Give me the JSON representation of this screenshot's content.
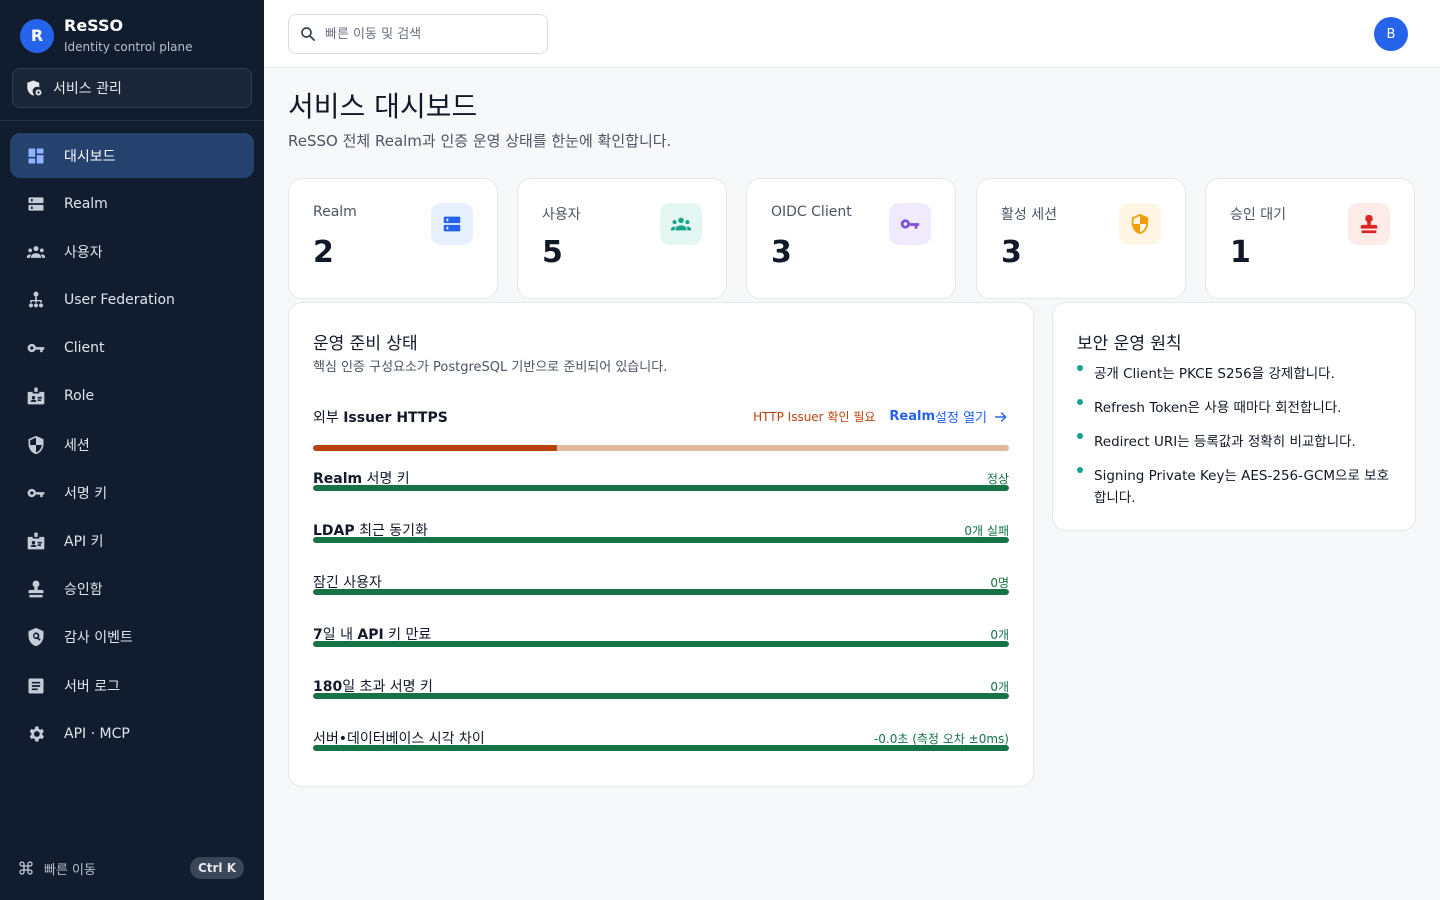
{
  "app": {
    "logo_letter": "R",
    "name": "ReSSO",
    "subtitle": "Identity control plane",
    "scope_label": "서비스 관리"
  },
  "sidebar": {
    "items": [
      {
        "label": "대시보드",
        "icon": "dashboard-icon",
        "active": true
      },
      {
        "label": "Realm",
        "icon": "server-icon"
      },
      {
        "label": "사용자",
        "icon": "users-icon"
      },
      {
        "label": "User Federation",
        "icon": "federation-icon"
      },
      {
        "label": "Client",
        "icon": "key-icon"
      },
      {
        "label": "Role",
        "icon": "badge-icon"
      },
      {
        "label": "세션",
        "icon": "shield-icon"
      },
      {
        "label": "서명 키",
        "icon": "key-icon"
      },
      {
        "label": "API 키",
        "icon": "badge-icon"
      },
      {
        "label": "승인함",
        "icon": "approval-icon"
      },
      {
        "label": "감사 이벤트",
        "icon": "audit-shield-icon"
      },
      {
        "label": "서버 로그",
        "icon": "log-icon"
      },
      {
        "label": "API · MCP",
        "icon": "gear-icon"
      }
    ],
    "quick_nav_label": "빠른 이동",
    "quick_nav_shortcut": "Ctrl K"
  },
  "topbar": {
    "search_placeholder": "빠른 이동 및 검색",
    "avatar_letter": "B"
  },
  "page": {
    "title": "서비스 대시보드",
    "subtitle": "ReSSO 전체 Realm과 인증 운영 상태를 한눈에 확인합니다."
  },
  "stats": [
    {
      "label": "Realm",
      "value": "2",
      "icon": "server-icon",
      "color": "#2563eb",
      "bg": "#e8effd"
    },
    {
      "label": "사용자",
      "value": "5",
      "icon": "users-icon",
      "color": "#14a38b",
      "bg": "#e3f6f1"
    },
    {
      "label": "OIDC Client",
      "value": "3",
      "icon": "key-icon",
      "color": "#7c4ddb",
      "bg": "#f0eafc"
    },
    {
      "label": "활성 세션",
      "value": "3",
      "icon": "shield-icon",
      "color": "#f59e0b",
      "bg": "#fef5e4"
    },
    {
      "label": "승인 대기",
      "value": "1",
      "icon": "approval-icon",
      "color": "#dc2626",
      "bg": "#fdebea"
    }
  ],
  "readiness": {
    "title": "운영 준비 상태",
    "description": "핵심 인증 구성요소가 PostgreSQL 기반으로 준비되어 있습니다.",
    "issuer": {
      "label_prefix": "외부 ",
      "label_strong": "Issuer HTTPS",
      "warning": "HTTP Issuer 확인 필요",
      "link_strong": "Realm",
      "link_rest": " 설정 열기",
      "progress": 0.35
    },
    "rows": [
      {
        "strong": "Realm",
        "rest": " 서명 키",
        "status": "정상",
        "progress": 1
      },
      {
        "strong": "LDAP",
        "rest": " 최근 동기화",
        "status": "0개 실패",
        "progress": 1
      },
      {
        "strong": "",
        "rest": "잠긴 사용자",
        "status": "0명",
        "progress": 1
      },
      {
        "strong": "7",
        "rest": "일 내 ",
        "strong2": "API",
        "rest2": " 키 만료",
        "status": "0개",
        "progress": 1
      },
      {
        "strong": "180",
        "rest": "일 초과 서명 키",
        "status": "0개",
        "progress": 1
      },
      {
        "strong": "",
        "rest": "서버•데이터베이스 시각 차이",
        "status": "-0.0초 (측정 오차 ±0ms)",
        "progress": 1
      }
    ],
    "colors": {
      "ok": "#157347",
      "warn": "#b8430f",
      "warn_track": "#e0b79f"
    }
  },
  "policy": {
    "title": "보안 운영 원칙",
    "items": [
      "공개 Client는 PKCE S256을 강제합니다.",
      "Refresh Token은 사용 때마다 회전합니다.",
      "Redirect URI는 등록값과 정확히 비교합니다.",
      "Signing Private Key는 AES-256-GCM으로 보호합니다."
    ]
  }
}
